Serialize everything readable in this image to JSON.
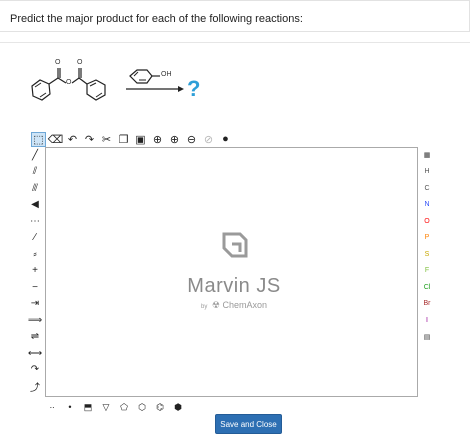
{
  "question": {
    "text": "Predict the major product for each of the following reactions:"
  },
  "reaction": {
    "reagent_label": "OH",
    "unknown_product": "?",
    "atom_label_oxygen": "O"
  },
  "editor": {
    "logo_text": "Marvin JS",
    "logo_by": "by",
    "logo_company": "ChemAxon",
    "element_buttons": [
      "H",
      "C",
      "N",
      "O",
      "P",
      "S",
      "F",
      "Cl",
      "Br",
      "I"
    ],
    "element_colors": {
      "H": "#555555",
      "C": "#555555",
      "N": "#3050F8",
      "O": "#FF0D0D",
      "P": "#FF8000",
      "S": "#C8A800",
      "F": "#80C040",
      "Cl": "#1FA01F",
      "Br": "#A62929",
      "I": "#940094"
    }
  },
  "footer": {
    "save_label": "Save and Close"
  }
}
